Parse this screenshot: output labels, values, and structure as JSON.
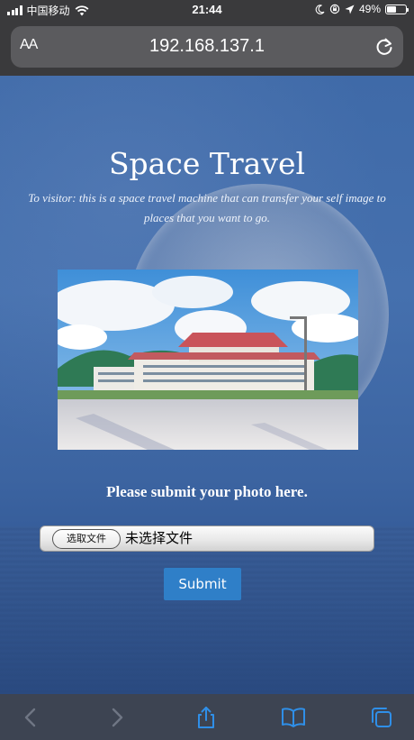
{
  "status_bar": {
    "carrier": "中国移动",
    "time": "21:44",
    "battery_percent": "49%",
    "battery_level": 0.49
  },
  "browser": {
    "text_size_label": "AA",
    "url": "192.168.137.1"
  },
  "page": {
    "title": "Space Travel",
    "intro": "To visitor: this is a space travel machine that can transfer your self image to places that you want to go.",
    "prompt": "Please submit your photo here.",
    "file_input": {
      "button_label": "选取文件",
      "status_text": "未选择文件"
    },
    "submit_label": "Submit"
  },
  "icons": {
    "status": [
      "signal-icon",
      "wifi-icon",
      "moon-icon",
      "rotation-lock-icon",
      "location-icon",
      "battery-icon"
    ],
    "toolbar": [
      "back-icon",
      "forward-icon",
      "share-icon",
      "bookmarks-icon",
      "tabs-icon"
    ]
  },
  "colors": {
    "submit": "#2f7fc8",
    "page_background": "#3f6aa8",
    "toolbar_bg": "#3a3a3c"
  }
}
